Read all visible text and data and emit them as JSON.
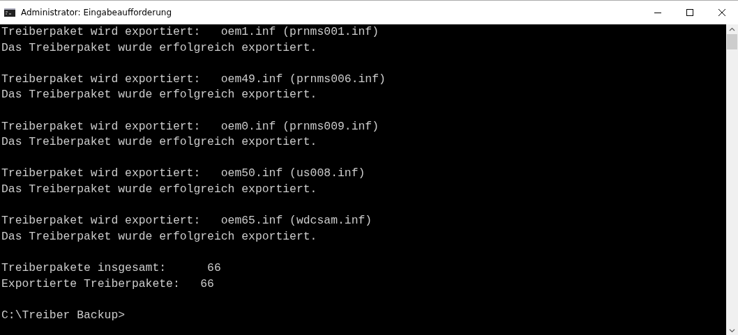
{
  "window": {
    "title": "Administrator: Eingabeaufforderung"
  },
  "console": {
    "blocks": [
      [
        "Treiberpaket wird exportiert:   oem1.inf (prnms001.inf)",
        "Das Treiberpaket wurde erfolgreich exportiert."
      ],
      [
        "Treiberpaket wird exportiert:   oem49.inf (prnms006.inf)",
        "Das Treiberpaket wurde erfolgreich exportiert."
      ],
      [
        "Treiberpaket wird exportiert:   oem0.inf (prnms009.inf)",
        "Das Treiberpaket wurde erfolgreich exportiert."
      ],
      [
        "Treiberpaket wird exportiert:   oem50.inf (us008.inf)",
        "Das Treiberpaket wurde erfolgreich exportiert."
      ],
      [
        "Treiberpaket wird exportiert:   oem65.inf (wdcsam.inf)",
        "Das Treiberpaket wurde erfolgreich exportiert."
      ],
      [
        "Treiberpakete insgesamt:      66",
        "Exportierte Treiberpakete:   66"
      ],
      [
        "C:\\Treiber Backup>"
      ]
    ]
  }
}
